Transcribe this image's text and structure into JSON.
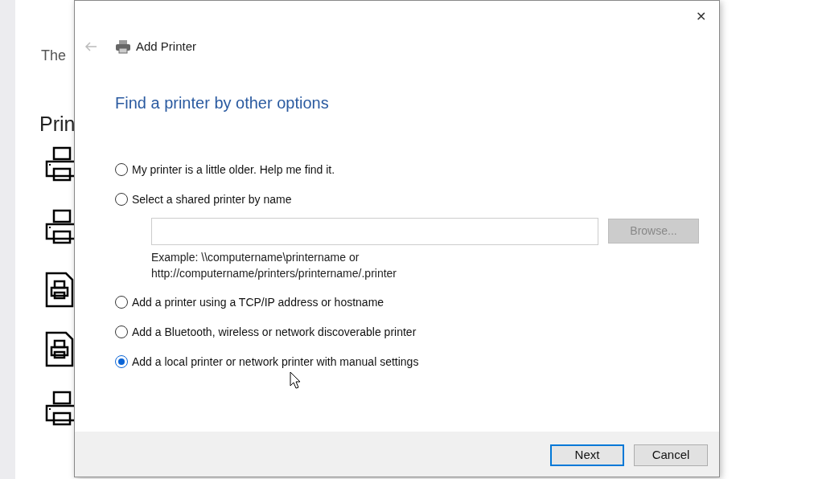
{
  "background": {
    "paragraph": "The",
    "heading": "Prin",
    "icons": [
      {
        "kind": "printer"
      },
      {
        "kind": "printer"
      },
      {
        "kind": "document"
      },
      {
        "kind": "document"
      },
      {
        "kind": "printer"
      }
    ]
  },
  "dialog": {
    "title": "Add Printer",
    "close": "✕",
    "heading": "Find a printer by other options",
    "options": [
      {
        "label": "My printer is a little older. Help me find it.",
        "selected": false
      },
      {
        "label": "Select a shared printer by name",
        "selected": false,
        "field": {
          "browse": {
            "label": "Browse...",
            "disabled": true
          },
          "example": [
            "Example: \\\\computername\\printername or",
            "http://computername/printers/printername/.printer"
          ]
        }
      },
      {
        "label": "Add a printer using a TCP/IP address or hostname",
        "selected": false
      },
      {
        "label": "Add a Bluetooth, wireless or network discoverable printer",
        "selected": false
      },
      {
        "label": "Add a local printer or network printer with manual settings",
        "selected": true
      }
    ],
    "buttons": [
      {
        "label": "Next",
        "default": true
      },
      {
        "label": "Cancel",
        "default": false
      }
    ]
  }
}
